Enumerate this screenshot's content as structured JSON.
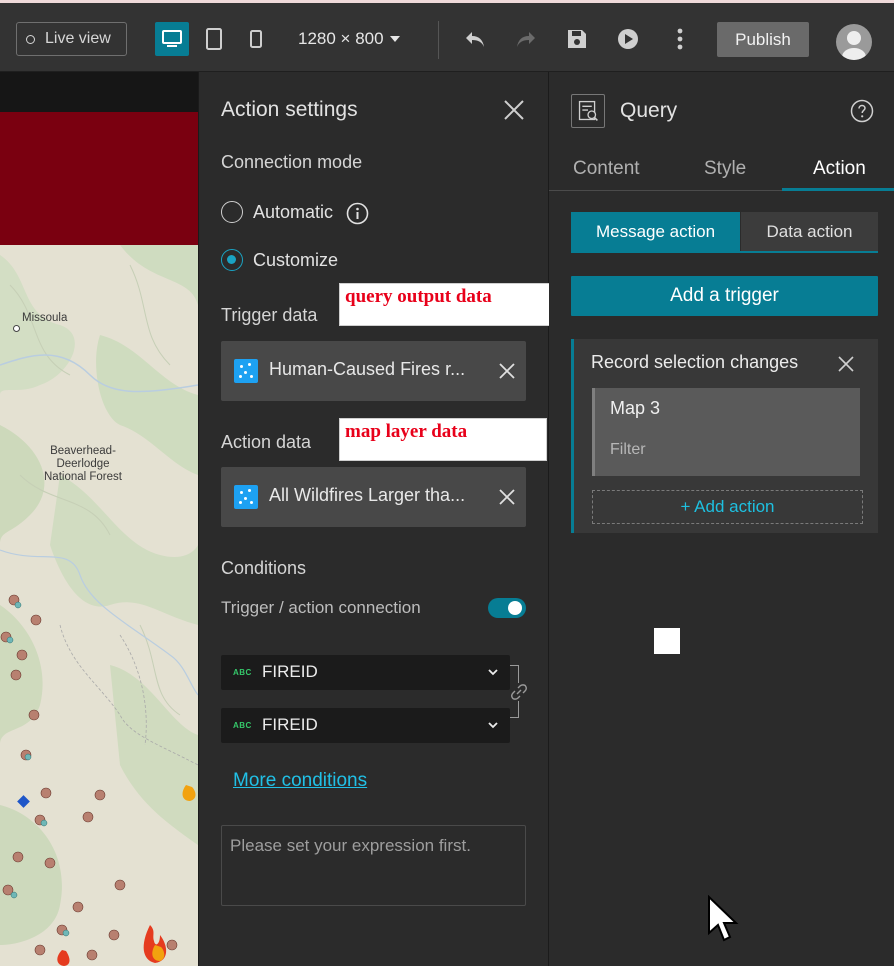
{
  "toolbar": {
    "live_view_label": "Live view",
    "resolution": "1280 × 800",
    "publish_label": "Publish"
  },
  "map": {
    "labels": {
      "missoula": "Missoula",
      "forest": "Beaverhead-\nDeerlodge\nNational Forest"
    }
  },
  "settings": {
    "title": "Action settings",
    "connection_mode_label": "Connection mode",
    "automatic_label": "Automatic",
    "customize_label": "Customize",
    "selected_mode": "Customize",
    "trigger_data_label": "Trigger data",
    "trigger_data_value": "Human-Caused Fires r...",
    "action_data_label": "Action data",
    "action_data_value": "All Wildfires Larger tha...",
    "conditions_label": "Conditions",
    "trigger_action_connection_label": "Trigger / action connection",
    "trigger_action_connection_on": true,
    "trigger_field": {
      "type_badge": "ABC",
      "name": "FIREID"
    },
    "action_field": {
      "type_badge": "ABC",
      "name": "FIREID"
    },
    "more_conditions_label": "More conditions",
    "expression_placeholder": "Please set your expression first."
  },
  "annotations": {
    "trigger": "query output data",
    "action": "map layer data"
  },
  "query": {
    "title": "Query",
    "tabs": [
      {
        "label": "Content",
        "active": false
      },
      {
        "label": "Style",
        "active": false
      },
      {
        "label": "Action",
        "active": true
      }
    ],
    "message_action_label": "Message action",
    "data_action_label": "Data action",
    "add_trigger_label": "Add a trigger",
    "trigger_card": {
      "title": "Record selection changes",
      "target": "Map 3",
      "action": "Filter",
      "add_action_label": "+ Add action"
    }
  },
  "colors": {
    "accent": "#077d94",
    "link": "#21c0e6",
    "annotation_text": "#e8001a",
    "banner": "#7a0010"
  }
}
